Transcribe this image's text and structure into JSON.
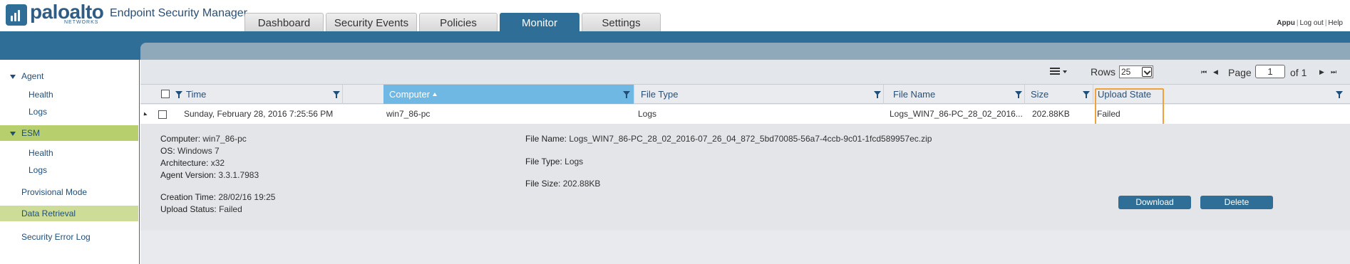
{
  "app": {
    "brand": "paloalto",
    "brand_sub": "NETWORKS",
    "title": "Endpoint Security Manager"
  },
  "user_links": {
    "user": "Appu",
    "logout": "Log out",
    "help": "Help"
  },
  "tabs": [
    {
      "label": "Dashboard",
      "active": false
    },
    {
      "label": "Security Events",
      "active": false
    },
    {
      "label": "Policies",
      "active": false
    },
    {
      "label": "Monitor",
      "active": true
    },
    {
      "label": "Settings",
      "active": false
    }
  ],
  "sidebar": {
    "agent": {
      "label": "Agent",
      "children": [
        "Health",
        "Logs"
      ]
    },
    "esm": {
      "label": "ESM",
      "children": [
        "Health",
        "Logs"
      ]
    },
    "items": [
      "Provisional Mode",
      "Data Retrieval",
      "Security Error Log"
    ],
    "selected": "Data Retrieval"
  },
  "toolbar": {
    "rows_label": "Rows",
    "rows_value": "25",
    "page_label": "Page",
    "page_value": "1",
    "page_of": "of 1"
  },
  "table": {
    "columns": [
      "Time",
      "Computer",
      "File Type",
      "File Name",
      "Size",
      "Upload State"
    ],
    "sorted_column": "Computer",
    "rows": [
      {
        "time": "Sunday, February 28, 2016 7:25:56 PM",
        "computer": "win7_86-pc",
        "file_type": "Logs",
        "file_name": "Logs_WIN7_86-PC_28_02_2016...",
        "size": "202.88KB",
        "upload_state": "Failed"
      }
    ]
  },
  "details": {
    "computer_k": "Computer:",
    "computer_v": "win7_86-pc",
    "os_k": "OS:",
    "os_v": "Windows 7",
    "arch_k": "Architecture:",
    "arch_v": "x32",
    "agent_version_k": "Agent Version:",
    "agent_version_v": "3.3.1.7983",
    "creation_time_k": "Creation Time:",
    "creation_time_v": "28/02/16 19:25",
    "upload_status_k": "Upload Status:",
    "upload_status_v": "Failed",
    "file_name_k": "File Name:",
    "file_name_v": "Logs_WIN7_86-PC_28_02_2016-07_26_04_872_5bd70085-56a7-4ccb-9c01-1fcd589957ec.zip",
    "file_type_k": "File Type:",
    "file_type_v": "Logs",
    "file_size_k": "File Size:",
    "file_size_v": "202.88KB",
    "download_label": "Download",
    "delete_label": "Delete"
  },
  "colors": {
    "brand_blue": "#2f6f97",
    "sidebar_highlight": "#b7cf6c",
    "sorted_header": "#6fb8e4",
    "upload_state_highlight": "#f0a13c"
  }
}
